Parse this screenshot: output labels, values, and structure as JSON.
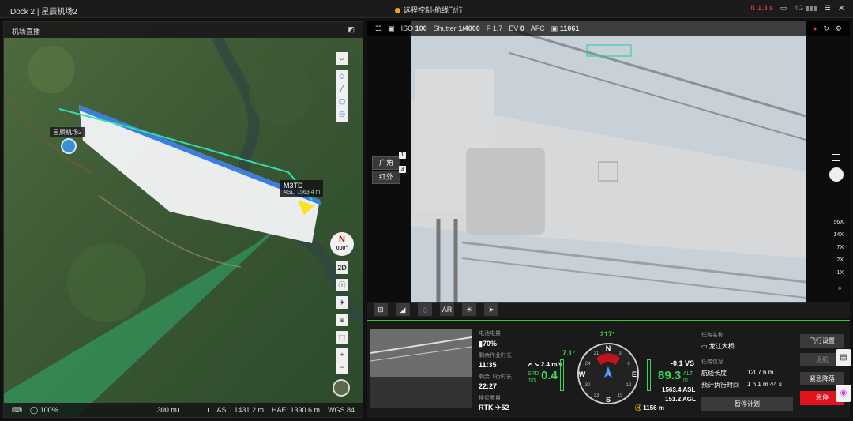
{
  "window": {
    "title": "Dock 2 | 星辰机场2",
    "status": "远程控制-航线飞行",
    "latency": "1.3 s",
    "signal": "4G"
  },
  "map": {
    "title": "机场直播",
    "dock_label": "星辰机场2",
    "drone_name": "M3TD",
    "drone_asl": "ASL: 1563.4 m",
    "compass_n": "N",
    "heading": "000°",
    "mode": "2D",
    "zoom_pct": "100%",
    "scale": "300 m",
    "asl": "ASL: 1431.2 m",
    "hae": "HAE: 1390.6 m",
    "datum": "WGS 84"
  },
  "camera": {
    "iso_label": "ISO",
    "iso": "100",
    "shutter_label": "Shutter",
    "shutter": "1/4000",
    "f": "F 1.7",
    "ev_label": "EV",
    "ev": "0",
    "focus": "AFC",
    "remain": "11061",
    "lens_wide": "广角",
    "lens_wide_num": "1",
    "lens_ir": "红外",
    "lens_ir_num": "3",
    "zooms": [
      "56X",
      "14X",
      "7X",
      "2X",
      "1X"
    ],
    "ar": "AR"
  },
  "telemetry": {
    "battery_label": "电池电量",
    "battery": "70%",
    "remain_label": "剩余作业时长",
    "remain": "11:35",
    "flight_label": "剩余飞行时长",
    "flight": "22:27",
    "search_label": "搜星质量",
    "rtk": "RTK",
    "sats": "52",
    "heading": "217°",
    "pitch": "7.1°",
    "hspd": "2.4 m/s",
    "spd_label": "SPD",
    "spd_unit": "m/s",
    "spd": "0.4",
    "vs": "-0.1 VS",
    "alt": "89.3",
    "alt_label": "ALT",
    "alt_unit": "m",
    "asl": "1563.4 ASL",
    "agl": "151.2 AGL",
    "home_dist": "1156 m",
    "compass": [
      "N",
      "E",
      "S",
      "W",
      "21",
      "24",
      "30",
      "33",
      "3",
      "6",
      "12",
      "15"
    ]
  },
  "mission": {
    "name_label": "任务名称",
    "name": "龙江大桥",
    "info_label": "任务信息",
    "len_label": "航线长度",
    "len": "1207.6 m",
    "time_label": "预计执行时间",
    "time": "1 h 1 m 44 s",
    "pause": "暂停计划"
  },
  "actions": {
    "settings": "飞行设置",
    "rth": "返航",
    "land": "紧急降落",
    "stop": "急停"
  }
}
